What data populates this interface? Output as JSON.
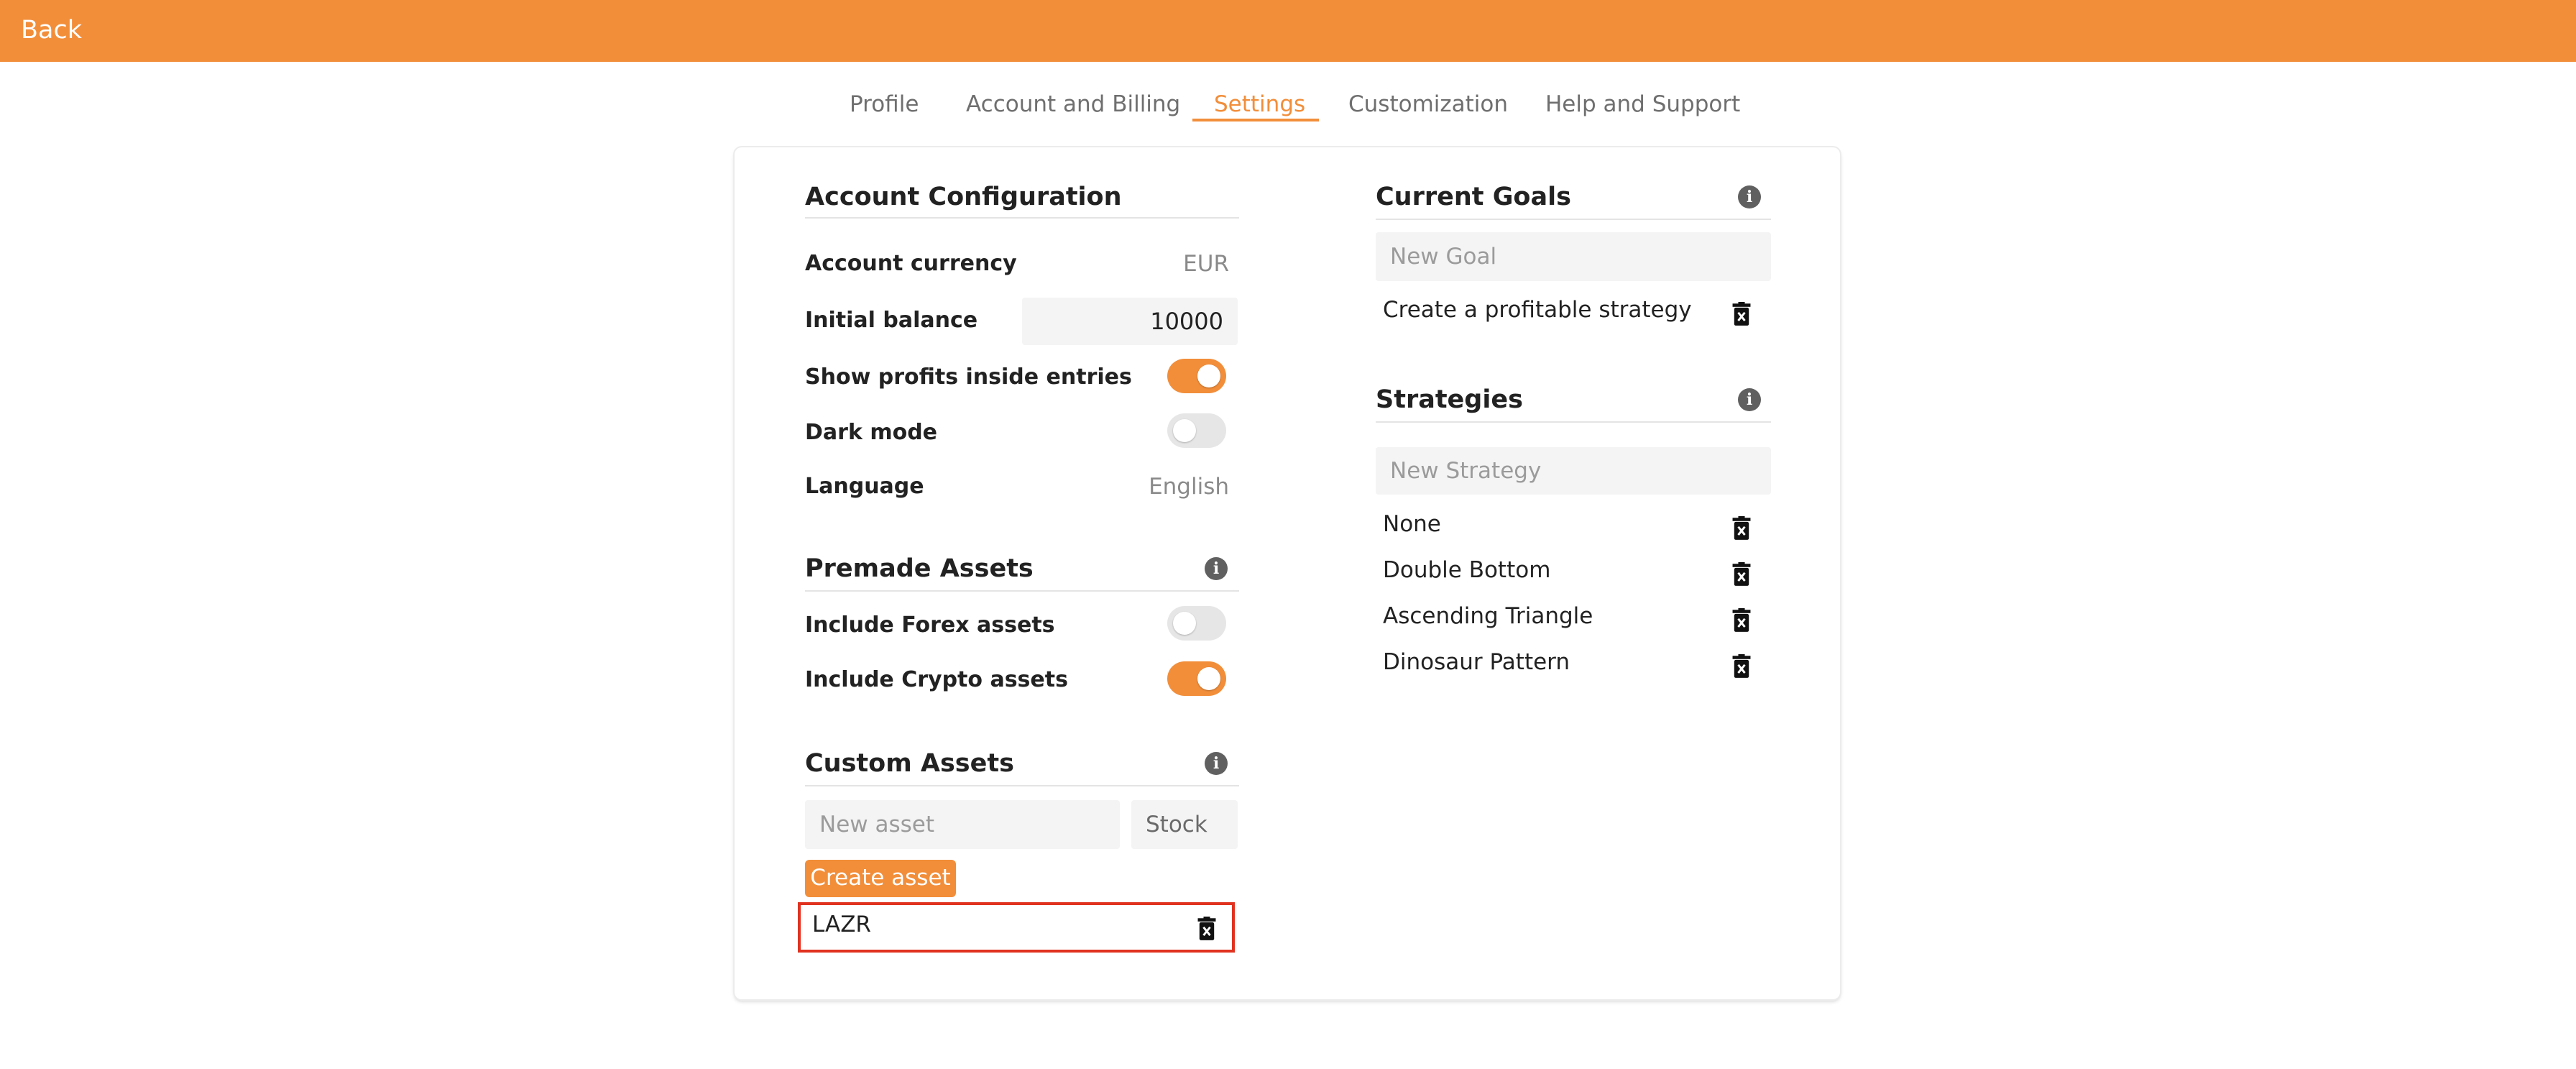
{
  "topbar": {
    "back_label": "Back"
  },
  "tabs": [
    {
      "label": "Profile"
    },
    {
      "label": "Account and Billing"
    },
    {
      "label": "Settings"
    },
    {
      "label": "Customization"
    },
    {
      "label": "Help and Support"
    }
  ],
  "active_tab": "Settings",
  "account_config": {
    "heading": "Account Configuration",
    "currency_label": "Account currency",
    "currency_value": "EUR",
    "balance_label": "Initial balance",
    "balance_value": "10000",
    "show_profits_label": "Show profits inside entries",
    "show_profits_on": true,
    "dark_mode_label": "Dark mode",
    "dark_mode_on": false,
    "language_label": "Language",
    "language_value": "English"
  },
  "premade_assets": {
    "heading": "Premade Assets",
    "forex_label": "Include Forex assets",
    "forex_on": false,
    "crypto_label": "Include Crypto assets",
    "crypto_on": true
  },
  "custom_assets": {
    "heading": "Custom Assets",
    "new_asset_placeholder": "New asset",
    "type_value": "Stock",
    "create_button": "Create asset",
    "items": [
      {
        "name": "LAZR"
      }
    ]
  },
  "current_goals": {
    "heading": "Current Goals",
    "new_goal_placeholder": "New Goal",
    "items": [
      {
        "name": "Create a profitable strategy"
      }
    ]
  },
  "strategies": {
    "heading": "Strategies",
    "new_strategy_placeholder": "New Strategy",
    "items": [
      {
        "name": "None"
      },
      {
        "name": "Double Bottom"
      },
      {
        "name": "Ascending Triangle"
      },
      {
        "name": "Dinosaur Pattern"
      }
    ]
  },
  "colors": {
    "accent": "#f28e3a",
    "highlight": "#e0321f"
  },
  "icons": {
    "info": "info-icon",
    "delete": "trash-icon"
  }
}
